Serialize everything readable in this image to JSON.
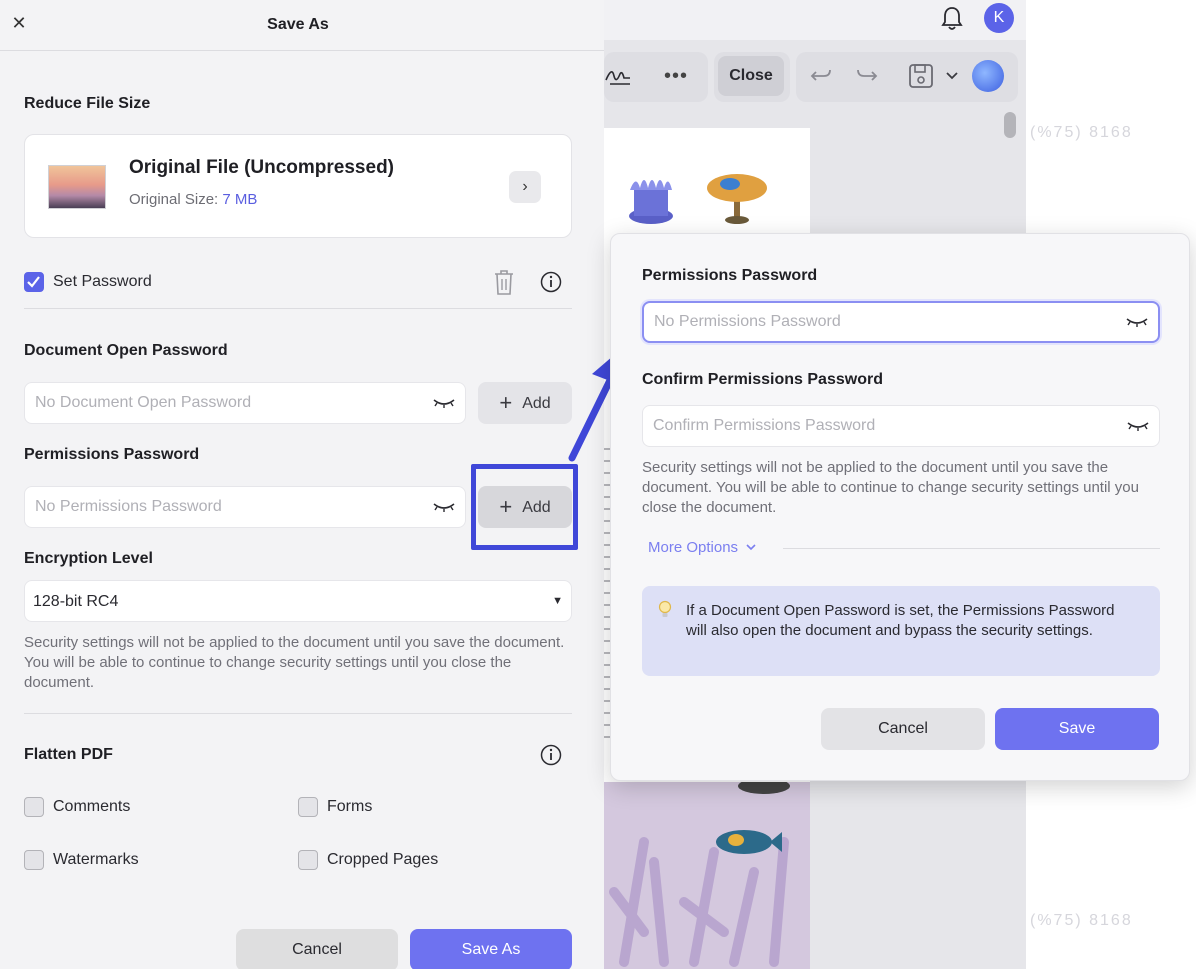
{
  "save_as_panel": {
    "title": "Save As",
    "close_icon": "close-icon",
    "reduce_file_size": {
      "heading": "Reduce File Size",
      "card_title": "Original File (Uncompressed)",
      "size_label": "Original Size:",
      "size_value": "7 MB"
    },
    "set_password": {
      "label": "Set Password",
      "checked": true
    },
    "document_open_password": {
      "heading": "Document Open Password",
      "placeholder": "No Document Open Password",
      "add_label": "Add"
    },
    "permissions_password": {
      "heading": "Permissions Password",
      "placeholder": "No Permissions Password",
      "add_label": "Add"
    },
    "encryption": {
      "heading": "Encryption Level",
      "selected": "128-bit RC4"
    },
    "security_note": "Security settings will not be applied to the document until you save the document. You will be able to continue to change security settings until you close the document.",
    "flatten_pdf": {
      "heading": "Flatten PDF",
      "options": [
        {
          "label": "Comments",
          "checked": false
        },
        {
          "label": "Forms",
          "checked": false
        },
        {
          "label": "Watermarks",
          "checked": false
        },
        {
          "label": "Cropped Pages",
          "checked": false
        }
      ]
    },
    "footer": {
      "cancel_label": "Cancel",
      "save_as_label": "Save As"
    }
  },
  "background_app": {
    "toolbar": {
      "close_label": "Close",
      "more_label": "•••"
    },
    "avatar_initial": "K",
    "watermarks": [
      "(%75)  8168",
      "(%75)  8168"
    ]
  },
  "permissions_popup": {
    "permissions_label": "Permissions Password",
    "permissions_placeholder": "No Permissions Password",
    "confirm_label": "Confirm Permissions Password",
    "confirm_placeholder": "Confirm Permissions Password",
    "note": "Security settings will not be applied to the document until you save the document. You will be able to continue to change security settings until you close the document.",
    "more_options_label": "More Options",
    "tip": "If a Document Open Password is set, the Permissions Password will also open the document and bypass the security settings.",
    "cancel_label": "Cancel",
    "save_label": "Save"
  },
  "colors": {
    "accent": "#6e72f0",
    "highlight_box": "#3f47d8",
    "checkbox_checked": "#5b63e8",
    "link": "#7b7ff0"
  }
}
